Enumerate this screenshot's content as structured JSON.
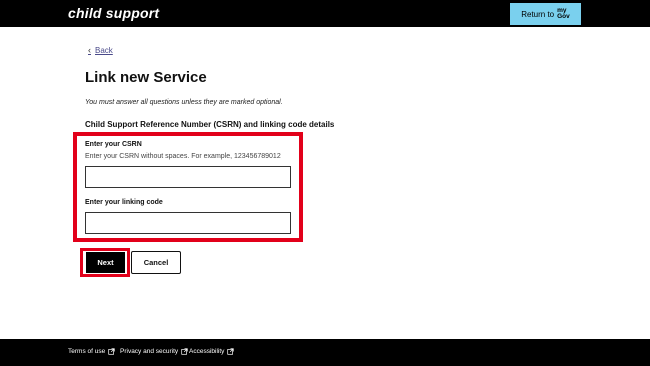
{
  "header": {
    "brand": "child support",
    "return_label": "Return to",
    "mygov_line1": "my",
    "mygov_line2": "Gov"
  },
  "main": {
    "back_label": "Back",
    "title": "Link new Service",
    "hint": "You must answer all questions unless they are marked optional.",
    "section_title": "Child Support Reference Number (CSRN) and linking code details",
    "csrn": {
      "label": "Enter your CSRN",
      "help": "Enter your CSRN without spaces. For example, 123456789012",
      "value": ""
    },
    "linking_code": {
      "label": "Enter your linking code",
      "value": ""
    },
    "next_label": "Next",
    "cancel_label": "Cancel"
  },
  "footer": {
    "links": [
      "Terms of use",
      "Privacy and security",
      "Accessibility"
    ]
  },
  "colors": {
    "header_bg": "#000000",
    "mygov_button": "#7ad0ee",
    "highlight": "#e2001a",
    "footer_bg": "#000000"
  },
  "icons": {
    "back": "chevron-left-icon",
    "external": "external-link-icon"
  }
}
